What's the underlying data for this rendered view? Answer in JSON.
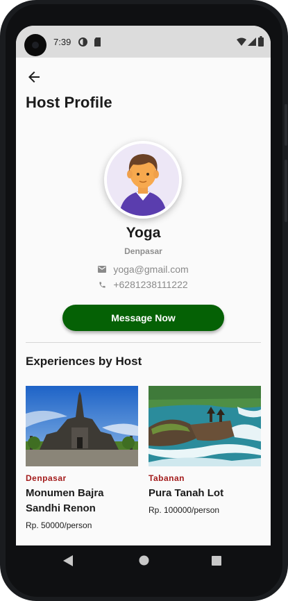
{
  "status_bar": {
    "time": "7:39",
    "icons": [
      "data-saver-icon",
      "sd-card-icon",
      "wifi-icon",
      "signal-icon",
      "battery-icon"
    ]
  },
  "header": {
    "back_icon": "arrow-left-icon",
    "title": "Host Profile"
  },
  "host": {
    "name": "Yoga",
    "city": "Denpasar",
    "email": "yoga@gmail.com",
    "phone": "+6281238111222",
    "avatar_icon": "person-avatar-icon"
  },
  "actions": {
    "message_label": "Message Now"
  },
  "experiences": {
    "section_title": "Experiences by Host",
    "items": [
      {
        "city": "Denpasar",
        "title": "Monumen Bajra Sandhi Renon",
        "price": "Rp. 50000/person",
        "image": "monument-photo"
      },
      {
        "city": "Tabanan",
        "title": "Pura Tanah Lot",
        "price": "Rp. 100000/person",
        "image": "sea-temple-photo"
      }
    ]
  },
  "nav_bar": {
    "buttons": [
      "back-triangle-icon",
      "home-circle-icon",
      "recents-square-icon"
    ]
  },
  "colors": {
    "primary_button": "#056105",
    "city_label": "#a31b1b",
    "avatar_bg": "#ede7f6"
  }
}
